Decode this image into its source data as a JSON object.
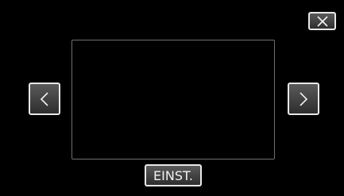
{
  "controls": {
    "close_icon": "close-icon",
    "prev_icon": "chevron-left-icon",
    "next_icon": "chevron-right-icon",
    "settings_label": "EINST."
  },
  "colors": {
    "background": "#000000",
    "frame_border": "#6f6f6f",
    "button_border": "#e8e8e8",
    "button_fill_top": "#5a5a5a",
    "button_fill_bottom": "#2e2e2e",
    "text": "#f2f2f2"
  }
}
